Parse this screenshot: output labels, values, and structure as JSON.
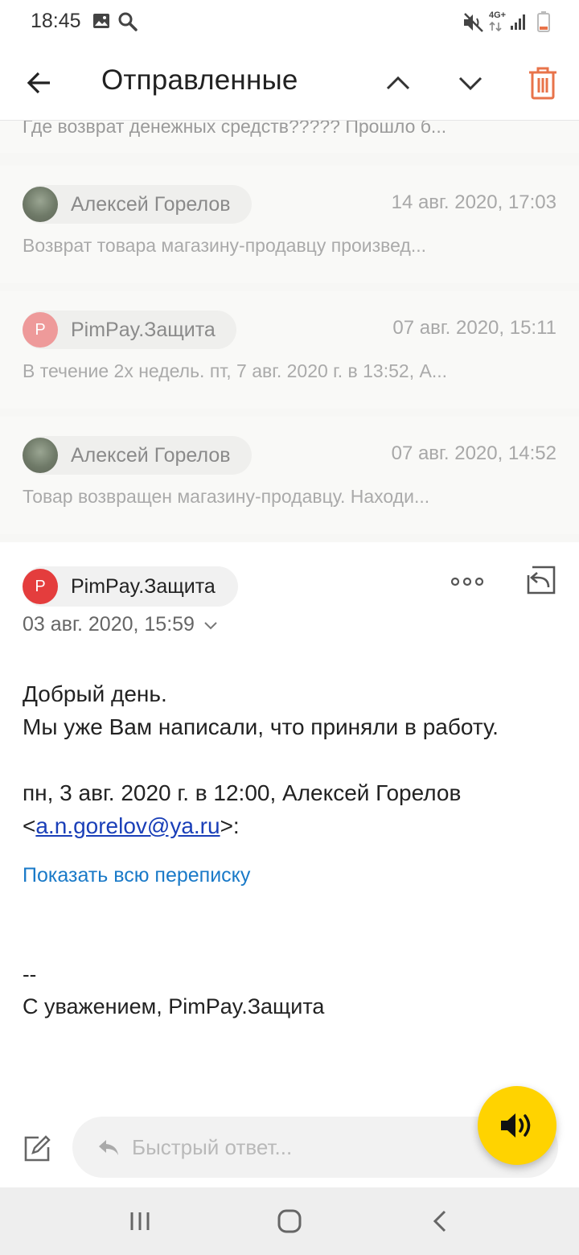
{
  "status_bar": {
    "time": "18:45",
    "network": "4G+",
    "icons": [
      "image-icon",
      "search-icon",
      "mute-vibrate-icon",
      "signal-icon",
      "battery-icon"
    ]
  },
  "appbar": {
    "title": "Отправленные",
    "icons": [
      "back-arrow-icon",
      "chevron-up-icon",
      "chevron-down-icon",
      "trash-icon"
    ]
  },
  "thread": {
    "truncated_snippet": "Где возврат денежных средств????? Прошло б...",
    "items": [
      {
        "sender": "Алексей Горелов",
        "avatar": "photo",
        "date": "14 авг. 2020, 17:03",
        "snippet": "Возврат товара магазину-продавцу произвед..."
      },
      {
        "sender": "PimPay.Защита",
        "avatar_letter": "P",
        "date": "07 авг. 2020, 15:11",
        "snippet": "В течение 2х недель. пт, 7 авг. 2020 г. в 13:52, А..."
      },
      {
        "sender": "Алексей Горелов",
        "avatar": "photo",
        "date": "07 авг. 2020, 14:52",
        "snippet": "Товар возвращен магазину-продавцу. Находи..."
      }
    ]
  },
  "message": {
    "sender": "PimPay.Защита",
    "avatar_letter": "P",
    "date": "03 авг. 2020, 15:59",
    "body_line1": "Добрый день.",
    "body_line2": "Мы уже Вам написали, что приняли в работу.",
    "quote_line1": "пн, 3 авг. 2020 г. в 12:00, Алексей Горелов",
    "quote_open": "<",
    "quote_email": "a.n.gorelov@ya.ru",
    "quote_close": ">:",
    "show_all": "Показать всю переписку",
    "signature_dash": "--",
    "signature": "С уважением, PimPay.Защита"
  },
  "quick_reply": {
    "placeholder": "Быстрый ответ..."
  },
  "colors": {
    "accent_trash": "#e8734a",
    "avatar_red": "#e43d3d",
    "link_blue": "#1a7ac8",
    "fab_yellow": "#ffd300"
  }
}
